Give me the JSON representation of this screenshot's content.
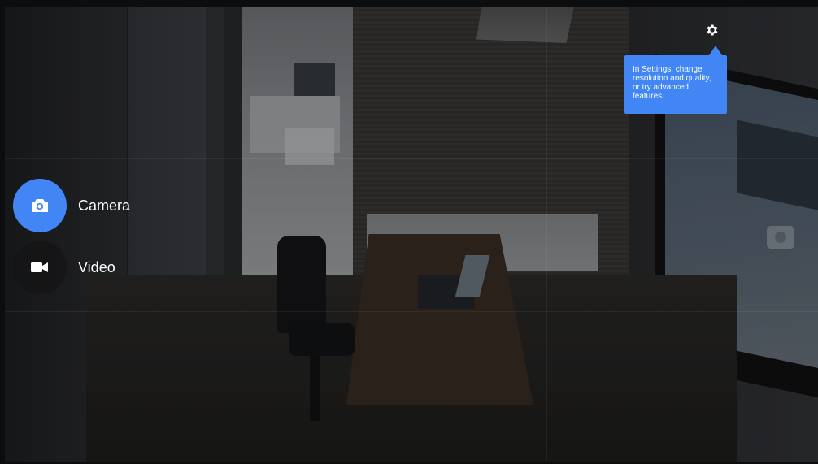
{
  "app": {
    "name": "camera-viewfinder"
  },
  "mode_switcher": {
    "items": [
      {
        "label": "Camera",
        "icon": "camera-icon",
        "selected": true
      },
      {
        "label": "Video",
        "icon": "video-icon",
        "selected": false
      }
    ]
  },
  "settings": {
    "icon": "gear-icon",
    "tooltip": "In Settings, change resolution and quality, or try advanced features."
  },
  "colors": {
    "accent": "#4285f4",
    "tooltip_bg": "#4285f4",
    "label_text": "#ffffff"
  }
}
